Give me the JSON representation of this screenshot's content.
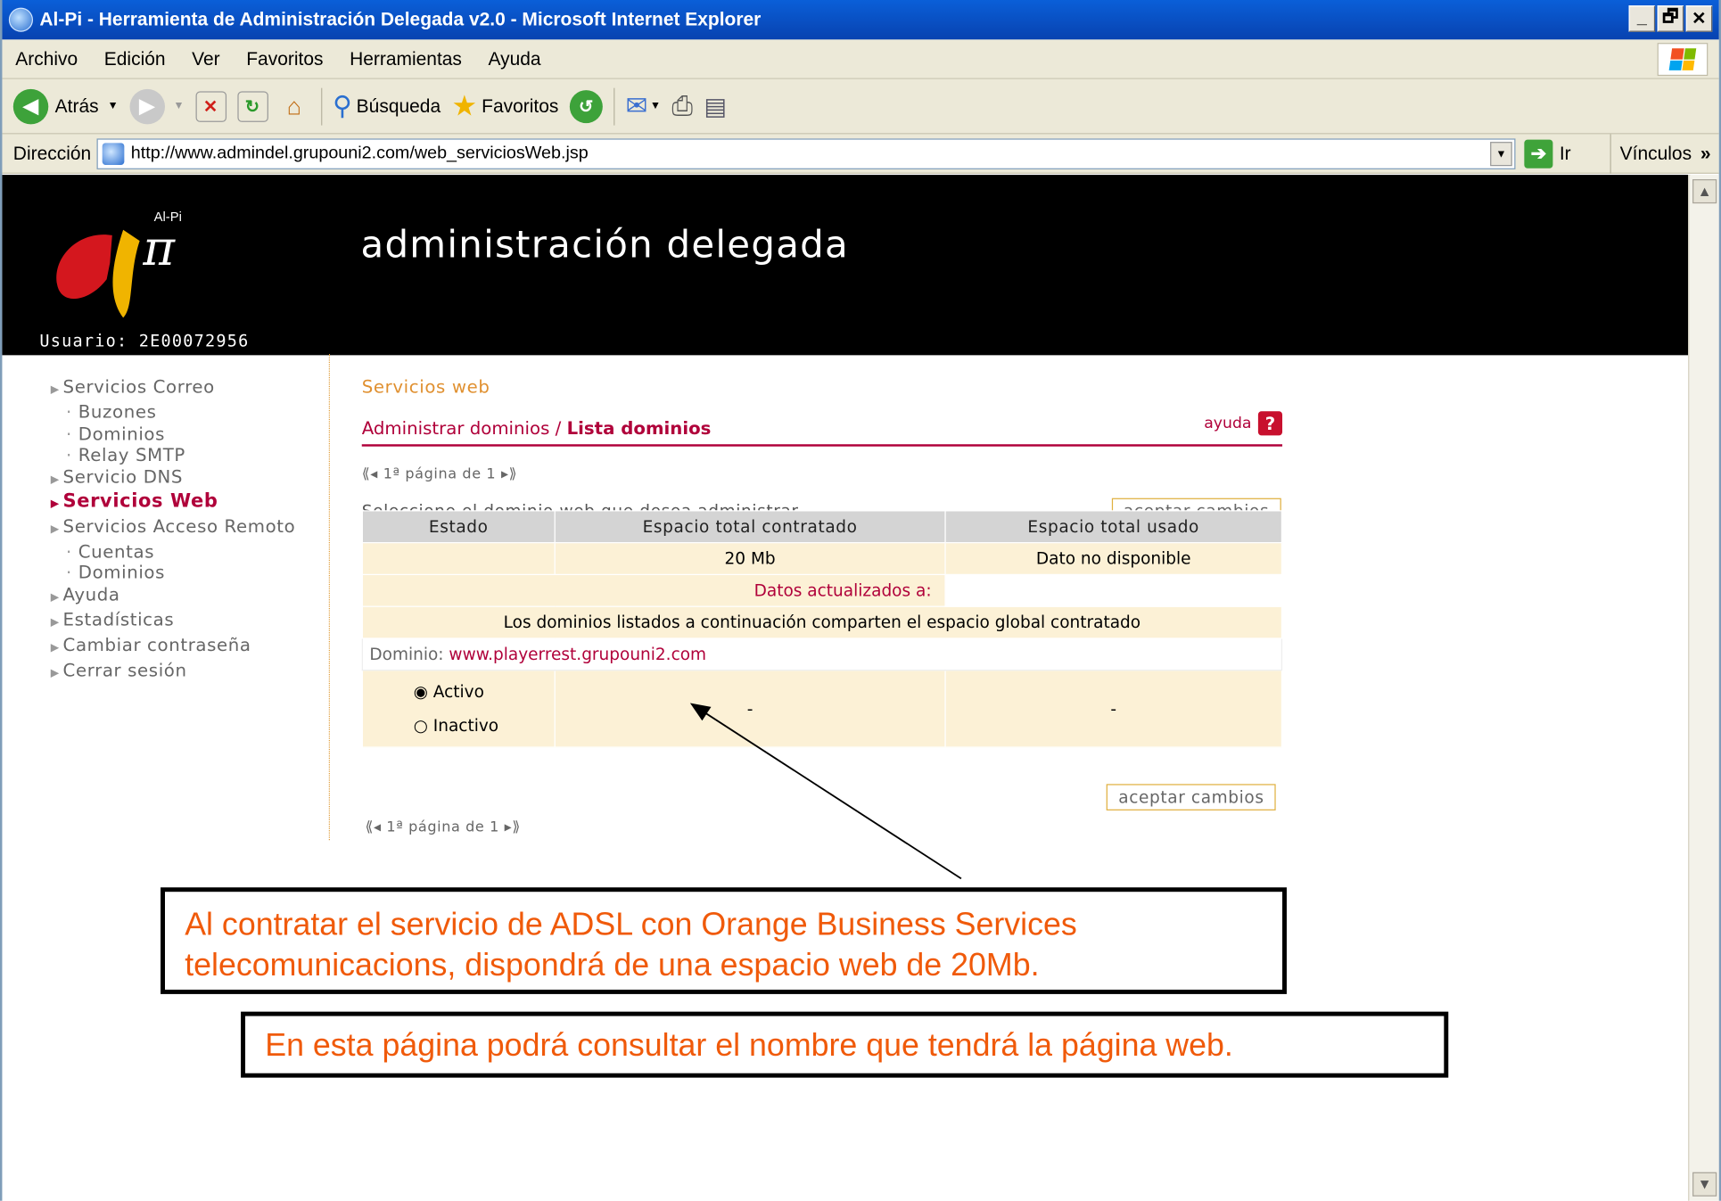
{
  "window": {
    "title": "Al-Pi - Herramienta de Administración Delegada v2.0 - Microsoft Internet Explorer",
    "controls": [
      "_",
      "🗗",
      "✕"
    ]
  },
  "menu": [
    "Archivo",
    "Edición",
    "Ver",
    "Favoritos",
    "Herramientas",
    "Ayuda"
  ],
  "toolbar": {
    "back": "Atrás",
    "search": "Búsqueda",
    "favorites": "Favoritos"
  },
  "address": {
    "label": "Dirección",
    "url": "http://www.admindel.grupouni2.com/web_serviciosWeb.jsp",
    "go": "Ir",
    "links": "Vínculos"
  },
  "header": {
    "logo_top": "Al-Pi",
    "logo_pi": "π",
    "title": "administración delegada",
    "user": "Usuario: 2E00072956"
  },
  "sidebar": [
    {
      "label": "Servicios Correo",
      "type": "top"
    },
    {
      "label": "Buzones",
      "type": "sub"
    },
    {
      "label": "Dominios",
      "type": "sub"
    },
    {
      "label": "Relay SMTP",
      "type": "sub"
    },
    {
      "label": "Servicio DNS",
      "type": "top"
    },
    {
      "label": "Servicios Web",
      "type": "active"
    },
    {
      "label": "Servicios Acceso Remoto",
      "type": "top"
    },
    {
      "label": "Cuentas",
      "type": "sub"
    },
    {
      "label": "Dominios",
      "type": "sub"
    },
    {
      "label": "Ayuda",
      "type": "top"
    },
    {
      "label": "Estadísticas",
      "type": "top"
    },
    {
      "label": "Cambiar contraseña",
      "type": "top"
    },
    {
      "label": "Cerrar sesión",
      "type": "top"
    }
  ],
  "main": {
    "section": "Servicios web",
    "crumb_link": "Administrar dominios",
    "crumb_sep": " / ",
    "crumb_current": "Lista dominios",
    "help": "ayuda",
    "pager": "1ª página de 1",
    "prompt": "Seleccione el dominio web que desea administrar",
    "accept": "aceptar cambios"
  },
  "table": {
    "headers": [
      "Estado",
      "Espacio total contratado",
      "Espacio total usado"
    ],
    "row1": [
      "",
      "20 Mb",
      "Dato no disponible"
    ],
    "updated": "Datos actualizados a:",
    "shared": "Los dominios listados a continuación comparten el espacio global contratado",
    "domain_label": "Dominio:",
    "domain": "www.playerrest.grupouni2.com",
    "status_active": "Activo",
    "status_inactive": "Inactivo",
    "status_selected": "Activo",
    "contracted": "-",
    "used": "-"
  },
  "notes": {
    "note1": "Al contratar el servicio de ADSL con Orange Business Services telecomunicacions, dispondrá de una espacio web de 20Mb.",
    "note2": "En esta página podrá consultar el nombre que tendrá la página web."
  },
  "colors": {
    "accent": "#b0003a",
    "section": "#e09030",
    "note_text": "#f05a0a"
  }
}
